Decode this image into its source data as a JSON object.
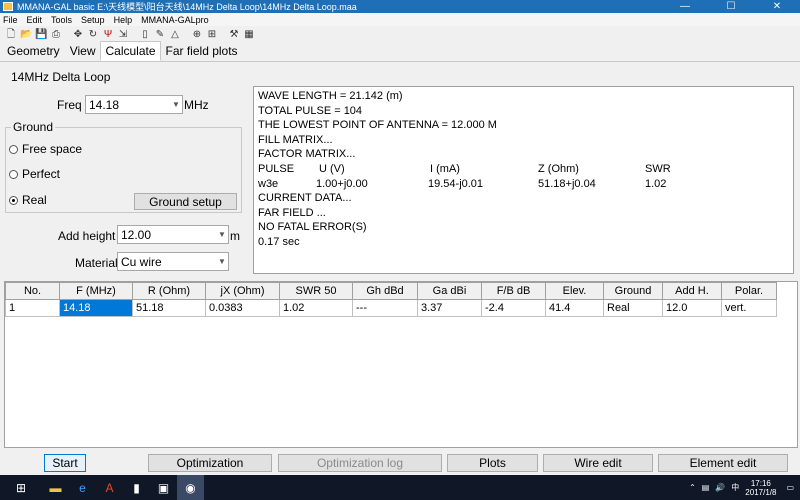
{
  "window": {
    "title": "MMANA-GAL basic E:\\天线模型\\阳台天线\\14MHz Delta Loop\\14MHz Delta Loop.maa",
    "minimize": "—",
    "maximize": "☐",
    "close": "✕"
  },
  "menu": [
    "File",
    "Edit",
    "Tools",
    "Setup",
    "Help",
    "MMANA-GALpro"
  ],
  "toolbar_icons": [
    "new-file-icon",
    "open-file-icon",
    "save-icon",
    "print-icon",
    "move-icon",
    "rotate-icon",
    "antenna-icon",
    "shrink-icon",
    "wire-icon",
    "draw-icon",
    "triangle-icon",
    "target-icon",
    "add-icon",
    "tools-icon",
    "calculator-icon"
  ],
  "tabs": [
    "Geometry",
    "View",
    "Calculate",
    "Far field plots"
  ],
  "active_tab": "Calculate",
  "antenna_name": "14MHz Delta Loop",
  "freq": {
    "label": "Freq",
    "value": "14.18",
    "unit": "MHz"
  },
  "ground": {
    "legend": "Ground",
    "options": [
      "Free space",
      "Perfect",
      "Real"
    ],
    "selected": "Real",
    "setup_button": "Ground setup"
  },
  "add_height": {
    "label": "Add height",
    "value": "12.00",
    "unit": "m"
  },
  "material": {
    "label": "Material",
    "value": "Cu wire"
  },
  "output": {
    "lines_top": [
      "WAVE LENGTH = 21.142 (m)",
      "TOTAL PULSE = 104",
      "THE LOWEST POINT OF ANTENNA = 12.000 M",
      "FILL MATRIX...",
      "FACTOR MATRIX..."
    ],
    "header": [
      "PULSE",
      "U (V)",
      "I (mA)",
      "Z (Ohm)",
      "SWR"
    ],
    "values": [
      "w3e",
      "1.00+j0.00",
      "19.54-j0.01",
      "51.18+j0.04",
      "1.02"
    ],
    "lines_bottom": [
      "CURRENT DATA...",
      "FAR FIELD ...",
      "NO FATAL ERROR(S)",
      "0.17 sec"
    ]
  },
  "results": {
    "columns": [
      "No.",
      "F (MHz)",
      "R (Ohm)",
      "jX (Ohm)",
      "SWR 50",
      "Gh dBd",
      "Ga dBi",
      "F/B dB",
      "Elev.",
      "Ground",
      "Add H.",
      "Polar."
    ],
    "rows": [
      [
        "1",
        "14.18",
        "51.18",
        "0.0383",
        "1.02",
        "---",
        "3.37",
        "-2.4",
        "41.4",
        "Real",
        "12.0",
        "vert."
      ]
    ]
  },
  "buttons": {
    "start": "Start",
    "optimization": "Optimization",
    "optimization_log": "Optimization log",
    "plots": "Plots",
    "wire_edit": "Wire edit",
    "element_edit": "Element edit"
  },
  "taskbar": {
    "ime": "中",
    "time": "17:16",
    "date": "2017/1/8"
  }
}
